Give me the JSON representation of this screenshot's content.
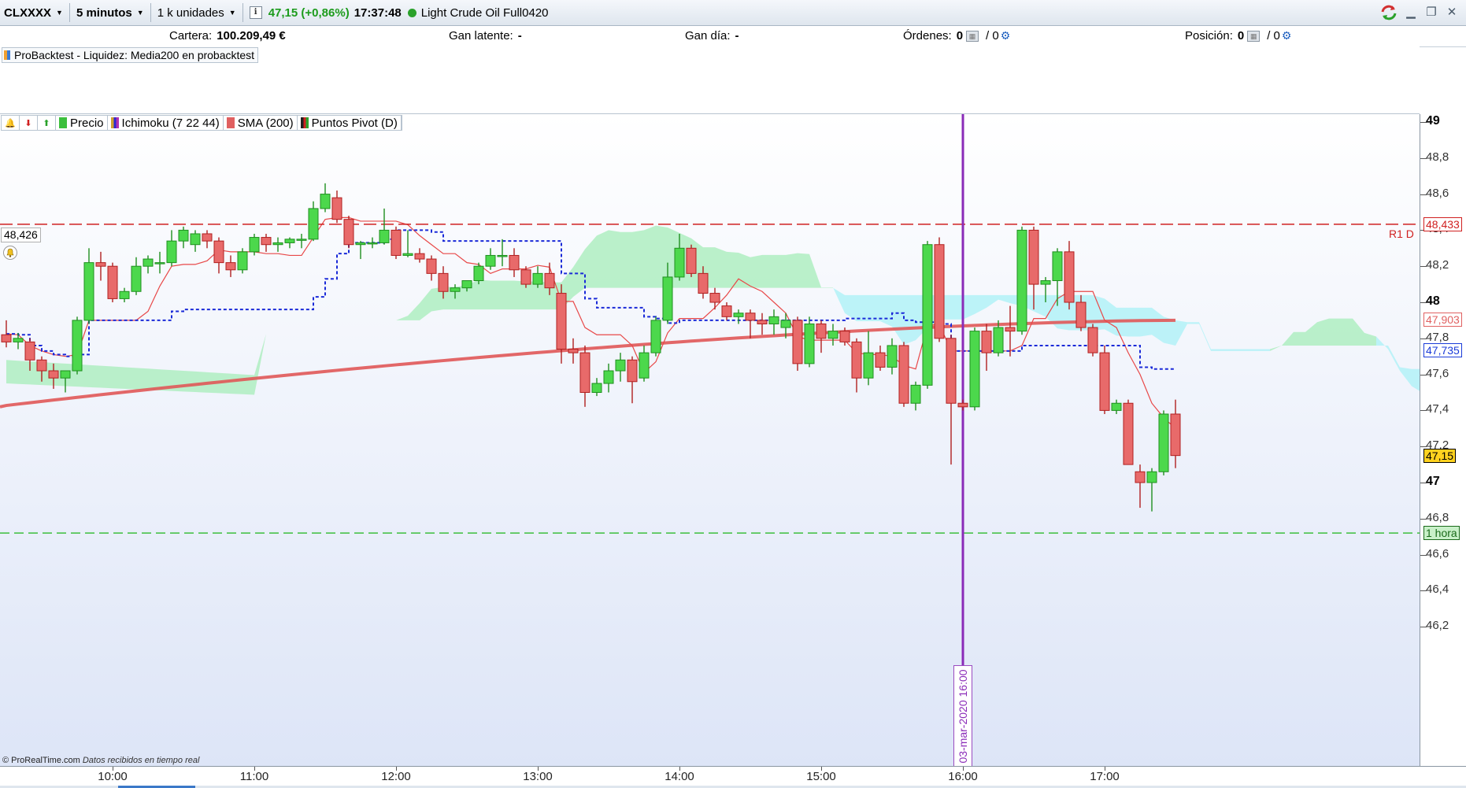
{
  "toolbar": {
    "ticker": "CLXXXX",
    "timeframe": "5 minutos",
    "units": "1 k unidades",
    "info_icon": "i",
    "price_change": "47,15 (+0,86%)",
    "clock": "17:37:48",
    "instrument": "Light Crude Oil Full0420"
  },
  "account": {
    "cartera_label": "Cartera:",
    "cartera_value": "100.209,49 €",
    "gan_latente_label": "Gan latente:",
    "gan_latente_value": "-",
    "gan_dia_label": "Gan día:",
    "gan_dia_value": "-",
    "ordenes_label": "Órdenes:",
    "ordenes_value": "0",
    "ordenes_sep": "/ 0",
    "posicion_label": "Posición:",
    "posicion_value": "0",
    "posicion_sep": "/ 0"
  },
  "probacktest": {
    "label": "ProBacktest - Liquidez: Media200 en probacktest"
  },
  "legend": {
    "items": [
      {
        "label": "Precio",
        "color": "#3cbf3c"
      },
      {
        "label": "Ichimoku (7 22 44)",
        "color": "#2a2ad0"
      },
      {
        "label": "SMA (200)",
        "color": "#e06060"
      },
      {
        "label": "Puntos Pivot (D)",
        "color": "#202020"
      }
    ]
  },
  "chart": {
    "left_value": "48,426",
    "r1_label": "R1 D",
    "vline_date": "03-mar-2020 16:00",
    "credit_brand": "© ProRealTime.com",
    "credit_note": "Datos recibidos en tiempo real"
  },
  "price_axis": {
    "labels": [
      {
        "v": 49.0,
        "t": "49",
        "big": true
      },
      {
        "v": 48.8,
        "t": "48,8"
      },
      {
        "v": 48.6,
        "t": "48,6"
      },
      {
        "v": 48.4,
        "t": "48,4"
      },
      {
        "v": 48.2,
        "t": "48,2"
      },
      {
        "v": 48.0,
        "t": "48",
        "big": true
      },
      {
        "v": 47.8,
        "t": "47,8"
      },
      {
        "v": 47.6,
        "t": "47,6"
      },
      {
        "v": 47.4,
        "t": "47,4"
      },
      {
        "v": 47.2,
        "t": "47,2"
      },
      {
        "v": 47.0,
        "t": "47",
        "big": true
      },
      {
        "v": 46.8,
        "t": "46,8"
      },
      {
        "v": 46.6,
        "t": "46,6"
      },
      {
        "v": 46.4,
        "t": "46,4"
      },
      {
        "v": 46.2,
        "t": "46,2"
      }
    ],
    "tags": [
      {
        "v": 48.433,
        "t": "48,433",
        "color": "#d02020",
        "bg": "#ffffff"
      },
      {
        "v": 47.903,
        "t": "47,903",
        "color": "#e06060",
        "bg": "#ffffff"
      },
      {
        "v": 47.735,
        "t": "47,735",
        "color": "#1a3bd8",
        "bg": "#ffffff"
      },
      {
        "v": 47.15,
        "t": "47,15",
        "color": "#000000",
        "bg": "#ffd21f"
      },
      {
        "v": 46.72,
        "t": "1 hora",
        "color": "#1a6a1a",
        "bg": "#c8f0c8"
      }
    ]
  },
  "time_axis": {
    "labels": [
      {
        "t": "10:00",
        "i": 9
      },
      {
        "t": "11:00",
        "i": 21
      },
      {
        "t": "12:00",
        "i": 33
      },
      {
        "t": "13:00",
        "i": 45
      },
      {
        "t": "14:00",
        "i": 57
      },
      {
        "t": "15:00",
        "i": 69
      },
      {
        "t": "16:00",
        "i": 81
      },
      {
        "t": "17:00",
        "i": 93
      }
    ]
  },
  "chart_data": {
    "type": "candlestick",
    "interval": "5 minutos",
    "ylim": [
      46.0,
      49.0
    ],
    "horizontal_lines": [
      {
        "name": "R1 D",
        "value": 48.433,
        "color": "#d02020",
        "style": "dashed"
      },
      {
        "name": "1 hora",
        "value": 46.72,
        "color": "#3cbf3c",
        "style": "dashed"
      }
    ],
    "vertical_line": {
      "i": 81,
      "label": "03-mar-2020 16:00",
      "color": "#8a2bb8"
    },
    "candles": [
      [
        47.82,
        47.9,
        47.75,
        47.78
      ],
      [
        47.78,
        47.83,
        47.74,
        47.8
      ],
      [
        47.78,
        47.8,
        47.62,
        47.68
      ],
      [
        47.68,
        47.7,
        47.56,
        47.62
      ],
      [
        47.62,
        47.66,
        47.52,
        47.58
      ],
      [
        47.58,
        47.62,
        47.5,
        47.62
      ],
      [
        47.62,
        47.92,
        47.6,
        47.9
      ],
      [
        47.9,
        48.3,
        47.88,
        48.22
      ],
      [
        48.22,
        48.28,
        48.12,
        48.2
      ],
      [
        48.2,
        48.22,
        48.0,
        48.02
      ],
      [
        48.02,
        48.08,
        48.0,
        48.06
      ],
      [
        48.06,
        48.25,
        48.04,
        48.2
      ],
      [
        48.2,
        48.26,
        48.16,
        48.24
      ],
      [
        48.22,
        48.28,
        48.16,
        48.22
      ],
      [
        48.22,
        48.4,
        48.2,
        48.34
      ],
      [
        48.34,
        48.42,
        48.3,
        48.4
      ],
      [
        48.32,
        48.4,
        48.28,
        48.38
      ],
      [
        48.38,
        48.4,
        48.3,
        48.34
      ],
      [
        48.34,
        48.36,
        48.16,
        48.22
      ],
      [
        48.22,
        48.26,
        48.14,
        48.18
      ],
      [
        48.18,
        48.3,
        48.16,
        48.28
      ],
      [
        48.28,
        48.38,
        48.26,
        48.36
      ],
      [
        48.36,
        48.38,
        48.28,
        48.32
      ],
      [
        48.32,
        48.36,
        48.28,
        48.33
      ],
      [
        48.33,
        48.36,
        48.3,
        48.35
      ],
      [
        48.35,
        48.38,
        48.3,
        48.35
      ],
      [
        48.35,
        48.56,
        48.34,
        48.52
      ],
      [
        48.52,
        48.66,
        48.5,
        48.6
      ],
      [
        48.58,
        48.62,
        48.44,
        48.46
      ],
      [
        48.46,
        48.48,
        48.3,
        48.32
      ],
      [
        48.32,
        48.34,
        48.24,
        48.33
      ],
      [
        48.33,
        48.36,
        48.3,
        48.33
      ],
      [
        48.33,
        48.52,
        48.32,
        48.4
      ],
      [
        48.4,
        48.42,
        48.24,
        48.26
      ],
      [
        48.26,
        48.4,
        48.25,
        48.27
      ],
      [
        48.27,
        48.3,
        48.22,
        48.24
      ],
      [
        48.24,
        48.26,
        48.12,
        48.16
      ],
      [
        48.16,
        48.2,
        48.02,
        48.06
      ],
      [
        48.06,
        48.1,
        48.02,
        48.08
      ],
      [
        48.08,
        48.12,
        48.06,
        48.12
      ],
      [
        48.12,
        48.22,
        48.1,
        48.2
      ],
      [
        48.2,
        48.3,
        48.18,
        48.26
      ],
      [
        48.26,
        48.35,
        48.2,
        48.26
      ],
      [
        48.26,
        48.3,
        48.14,
        48.18
      ],
      [
        48.18,
        48.2,
        48.08,
        48.1
      ],
      [
        48.1,
        48.2,
        48.08,
        48.16
      ],
      [
        48.16,
        48.22,
        48.04,
        48.08
      ],
      [
        48.05,
        48.1,
        47.66,
        47.74
      ],
      [
        47.74,
        47.8,
        47.66,
        47.72
      ],
      [
        47.72,
        47.76,
        47.42,
        47.5
      ],
      [
        47.5,
        47.58,
        47.48,
        47.55
      ],
      [
        47.55,
        47.66,
        47.5,
        47.62
      ],
      [
        47.62,
        47.72,
        47.56,
        47.68
      ],
      [
        47.68,
        47.7,
        47.44,
        47.56
      ],
      [
        47.58,
        47.76,
        47.56,
        47.72
      ],
      [
        47.72,
        47.92,
        47.7,
        47.9
      ],
      [
        47.9,
        48.22,
        47.88,
        48.14
      ],
      [
        48.14,
        48.38,
        48.12,
        48.3
      ],
      [
        48.3,
        48.32,
        48.14,
        48.16
      ],
      [
        48.16,
        48.2,
        48.02,
        48.05
      ],
      [
        48.05,
        48.08,
        47.96,
        48.0
      ],
      [
        47.98,
        48.0,
        47.9,
        47.92
      ],
      [
        47.92,
        47.96,
        47.88,
        47.94
      ],
      [
        47.94,
        47.96,
        47.8,
        47.9
      ],
      [
        47.9,
        47.94,
        47.82,
        47.88
      ],
      [
        47.88,
        47.96,
        47.82,
        47.92
      ],
      [
        47.86,
        47.94,
        47.8,
        47.9
      ],
      [
        47.9,
        47.92,
        47.62,
        47.66
      ],
      [
        47.66,
        47.92,
        47.64,
        47.88
      ],
      [
        47.88,
        47.9,
        47.72,
        47.8
      ],
      [
        47.8,
        47.88,
        47.76,
        47.84
      ],
      [
        47.84,
        47.86,
        47.76,
        47.78
      ],
      [
        47.78,
        47.8,
        47.5,
        47.58
      ],
      [
        47.58,
        47.84,
        47.54,
        47.72
      ],
      [
        47.72,
        47.76,
        47.62,
        47.64
      ],
      [
        47.64,
        47.8,
        47.6,
        47.76
      ],
      [
        47.76,
        47.78,
        47.42,
        47.44
      ],
      [
        47.44,
        47.56,
        47.4,
        47.54
      ],
      [
        47.54,
        48.34,
        47.52,
        48.32
      ],
      [
        48.32,
        48.36,
        47.78,
        47.8
      ],
      [
        47.8,
        47.82,
        47.1,
        47.44
      ],
      [
        47.44,
        47.46,
        47.4,
        47.42
      ],
      [
        47.42,
        47.86,
        47.4,
        47.84
      ],
      [
        47.84,
        47.88,
        47.62,
        47.72
      ],
      [
        47.72,
        47.9,
        47.7,
        47.86
      ],
      [
        47.86,
        47.98,
        47.7,
        47.84
      ],
      [
        47.84,
        48.42,
        47.82,
        48.4
      ],
      [
        48.4,
        48.42,
        47.96,
        48.1
      ],
      [
        48.1,
        48.14,
        48.0,
        48.12
      ],
      [
        48.12,
        48.3,
        47.98,
        48.28
      ],
      [
        48.28,
        48.34,
        47.96,
        48.0
      ],
      [
        48.0,
        48.04,
        47.84,
        47.86
      ],
      [
        47.86,
        47.88,
        47.7,
        47.72
      ],
      [
        47.72,
        47.76,
        47.38,
        47.4
      ],
      [
        47.4,
        47.46,
        47.38,
        47.44
      ],
      [
        47.44,
        47.46,
        47.1,
        47.1
      ],
      [
        47.06,
        47.1,
        46.86,
        47.0
      ],
      [
        47.0,
        47.08,
        46.84,
        47.06
      ],
      [
        47.06,
        47.4,
        47.04,
        47.38
      ],
      [
        47.38,
        47.46,
        47.08,
        47.15
      ]
    ]
  }
}
